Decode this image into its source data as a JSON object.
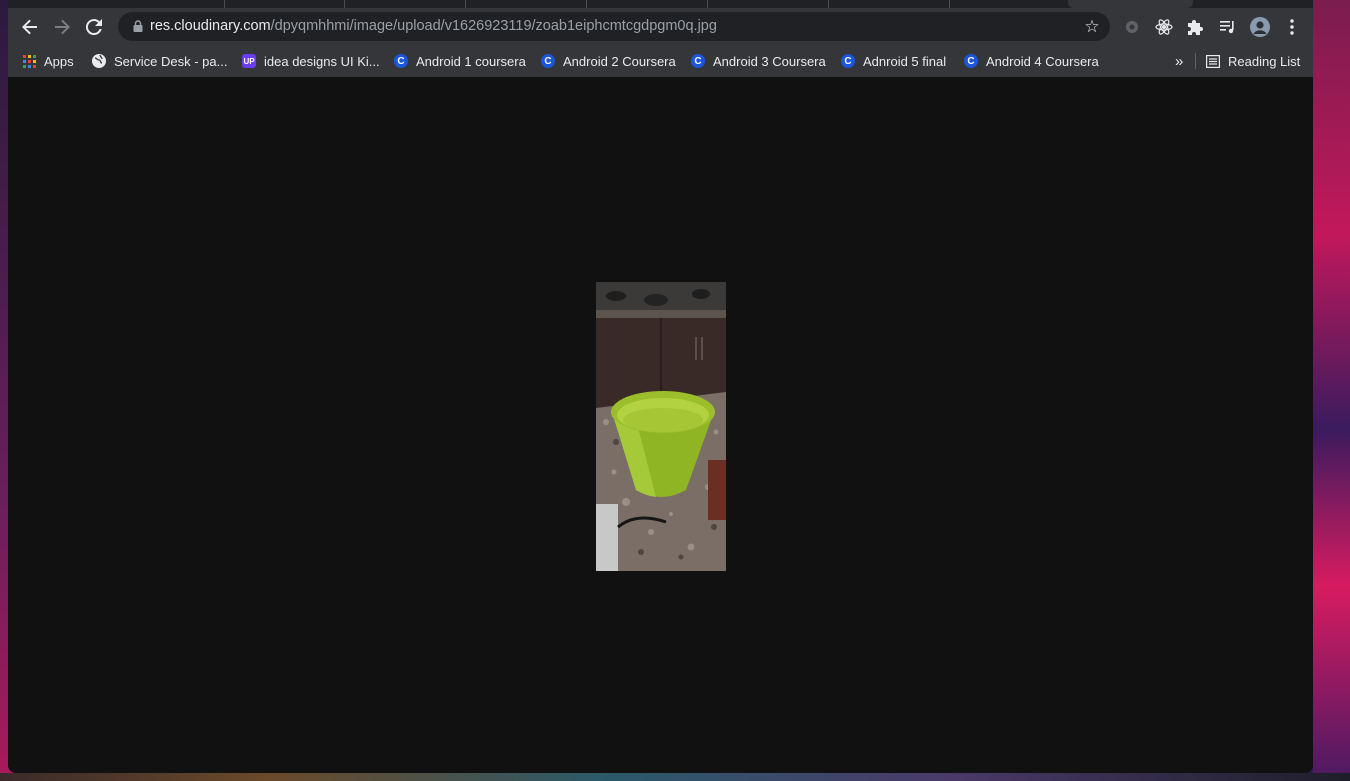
{
  "browser": {
    "address_bar": {
      "host": "res.cloudinary.com",
      "path": "/dpyqmhhmi/image/upload/v1626923119/zoab1eiphcmtcgdpgm0q.jpg"
    },
    "toolbar_icons": [
      "back-icon",
      "forward-icon",
      "reload-icon",
      "lock-icon",
      "star-icon",
      "extension-icon",
      "react-devtools-icon",
      "puzzle-icon",
      "media-control-icon",
      "avatar",
      "kebab-menu-icon"
    ]
  },
  "bookmarks": {
    "apps_label": "Apps",
    "items": [
      {
        "label": "Service Desk - pa...",
        "icon": "globe-icon"
      },
      {
        "label": "idea designs UI Ki...",
        "icon": "upwork-icon",
        "fav_text": "UP"
      },
      {
        "label": "Android 1 coursera",
        "icon": "coursera-icon",
        "fav_text": "C"
      },
      {
        "label": "Android 2 Coursera",
        "icon": "coursera-icon",
        "fav_text": "C"
      },
      {
        "label": "Android 3 Coursera",
        "icon": "coursera-icon",
        "fav_text": "C"
      },
      {
        "label": "Adnroid 5 final",
        "icon": "coursera-icon",
        "fav_text": "C"
      },
      {
        "label": "Android 4 Coursera",
        "icon": "coursera-icon",
        "fav_text": "C"
      }
    ],
    "overflow_label": "»",
    "reading_list_label": "Reading List"
  },
  "colors": {
    "content_background": "#111111",
    "toolbar_background": "#35363a",
    "omnibox_background": "#202124",
    "coursera_blue": "#1a56db",
    "cup_green": "#9bbf2a"
  }
}
